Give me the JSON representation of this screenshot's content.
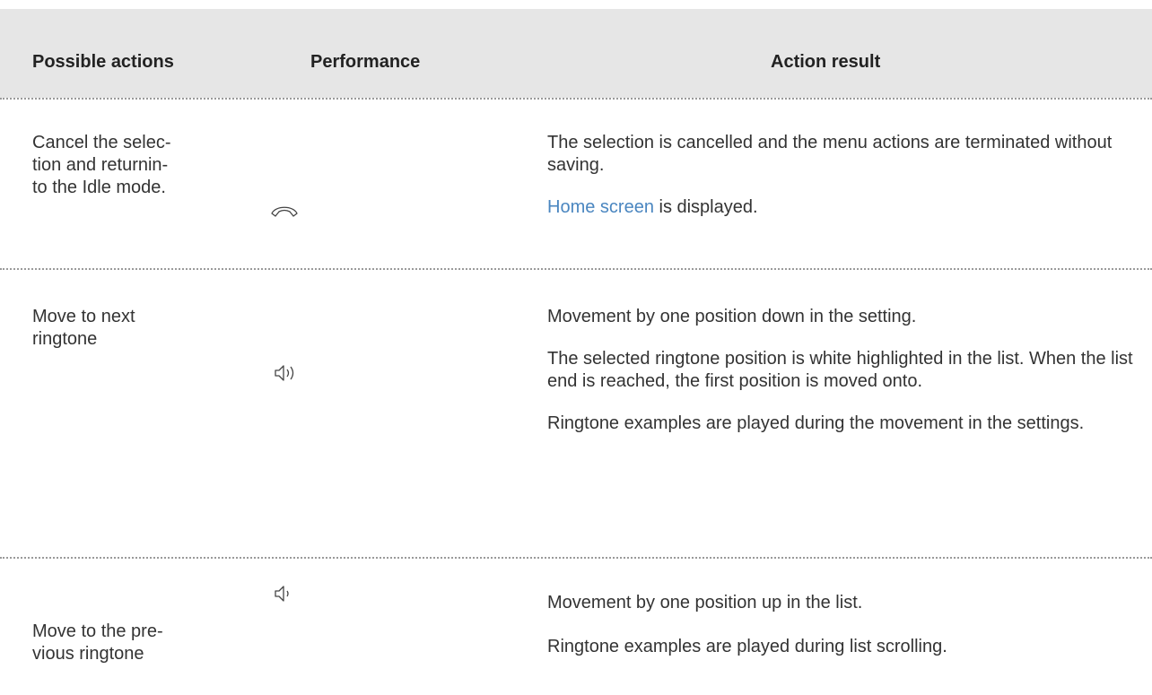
{
  "table": {
    "headers": {
      "possible_actions": "Possible actions",
      "performance": "Performance",
      "action_result": "Action result"
    },
    "rows": [
      {
        "action": "Cancel the selec-\ntion and returnin-\nto the Idle mode.",
        "performance_icon": "handset-hang-up-icon",
        "result": {
          "p1": "The selection is cancelled and the menu actions are terminated without saving.",
          "p2_link": "Home screen",
          "p2_rest": " is displayed."
        }
      },
      {
        "action": "Move to next\nringtone",
        "performance_icon": "volume-up-icon",
        "result": {
          "p1": "Movement by one position down in the setting.",
          "p2": "The selected ringtone position is white highlighted in the list. When the list end is reached, the first position is moved onto.",
          "p3": "Ringtone examples are played during the movement in the settings."
        }
      },
      {
        "action": "Move to the pre-\nvious ringtone",
        "performance_icon": "volume-down-icon",
        "result": {
          "p1": "Movement by one position up in the list.",
          "p2": "Ringtone examples are played during list scrolling."
        }
      }
    ]
  },
  "colors": {
    "header_bg": "#e6e6e6",
    "text": "#333333",
    "link": "#4a86c0",
    "separator": "#9a9a9a"
  }
}
